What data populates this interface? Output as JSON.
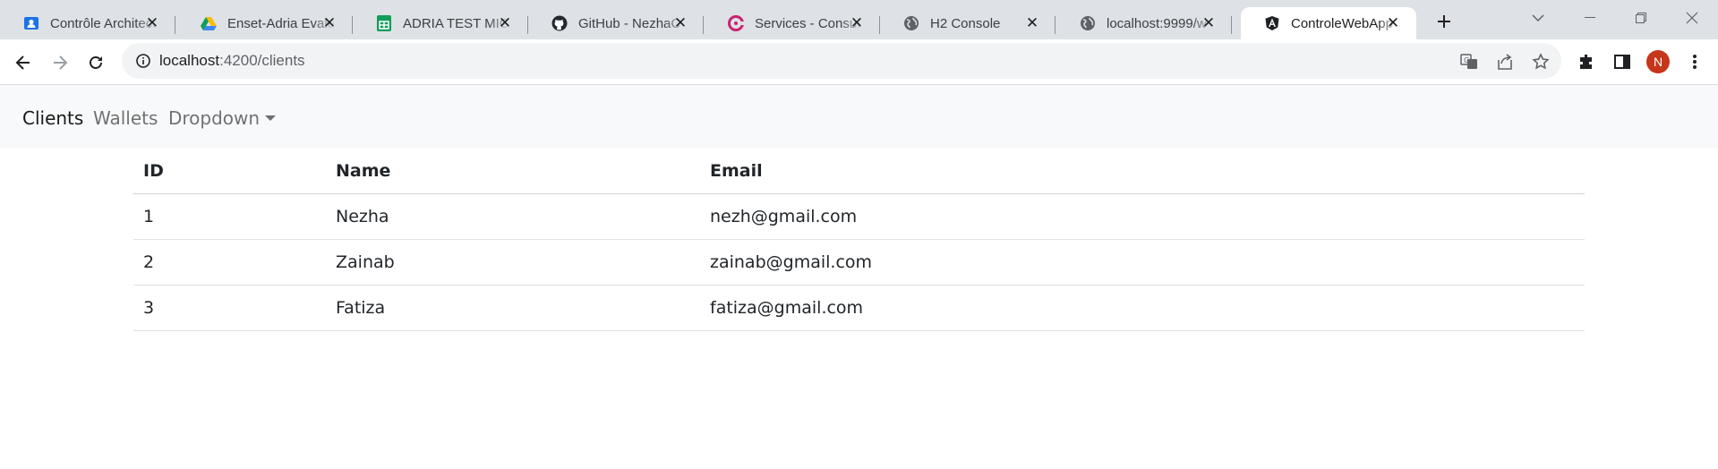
{
  "browser": {
    "tabs": [
      {
        "title": "Contrôle Architecture",
        "icon": "classroom-icon",
        "active": false
      },
      {
        "title": "Enset-Adria Evaluation",
        "icon": "google-drive-icon",
        "active": false
      },
      {
        "title": "ADRIA TEST MICRO",
        "icon": "google-sheets-icon",
        "active": false
      },
      {
        "title": "GitHub - NezhaC",
        "icon": "github-icon",
        "active": false
      },
      {
        "title": "Services - Consul",
        "icon": "consul-icon",
        "active": false
      },
      {
        "title": "H2 Console",
        "icon": "globe-icon",
        "active": false
      },
      {
        "title": "localhost:9999/w",
        "icon": "globe-icon",
        "active": false
      },
      {
        "title": "ControleWebApp",
        "icon": "angular-icon",
        "active": true
      }
    ],
    "address": {
      "host": "localhost",
      "path": ":4200/clients"
    },
    "profile_initial": "N"
  },
  "app": {
    "navbar": {
      "links": [
        "Clients",
        "Wallets"
      ],
      "dropdown_label": "Dropdown"
    },
    "table": {
      "headers": [
        "ID",
        "Name",
        "Email"
      ],
      "rows": [
        [
          "1",
          "Nezha",
          "nezh@gmail.com"
        ],
        [
          "2",
          "Zainab",
          "zainab@gmail.com"
        ],
        [
          "3",
          "Fatiza",
          "fatiza@gmail.com"
        ]
      ]
    }
  },
  "colors": {
    "tabstrip": "#dee1e6",
    "navbar_bg": "#f8f9fa",
    "avatar": "#c5361b"
  }
}
